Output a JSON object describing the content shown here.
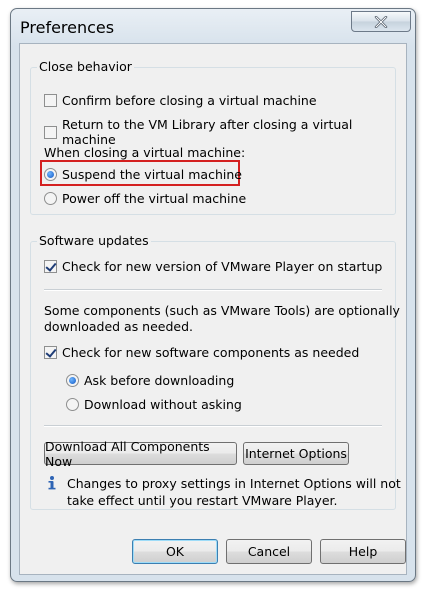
{
  "window": {
    "title": "Preferences"
  },
  "close_behavior": {
    "legend": "Close behavior",
    "confirm_label": "Confirm before closing a virtual machine",
    "confirm_checked": false,
    "return_label": "Return to the VM Library after closing a virtual machine",
    "return_checked": false,
    "when_closing_label": "When closing a virtual machine:",
    "suspend_label": "Suspend the virtual machine",
    "suspend_selected": true,
    "poweroff_label": "Power off the virtual machine",
    "poweroff_selected": false
  },
  "software_updates": {
    "legend": "Software updates",
    "check_version_label": "Check for new version of VMware Player on startup",
    "check_version_checked": true,
    "components_note_line1": "Some components (such as VMware Tools) are optionally",
    "components_note_line2": "downloaded as needed.",
    "check_components_label": "Check for new software components as needed",
    "check_components_checked": true,
    "ask_label": "Ask before downloading",
    "ask_selected": true,
    "download_label": "Download without asking",
    "download_selected": false,
    "download_all_button": "Download All Components Now",
    "internet_options_button": "Internet Options",
    "proxy_note_line1": "Changes to proxy settings in Internet Options will not",
    "proxy_note_line2": "take effect until you restart VMware Player."
  },
  "buttons": {
    "ok": "OK",
    "cancel": "Cancel",
    "help": "Help"
  },
  "icons": {
    "close": "close-icon",
    "info": "info-icon"
  },
  "colors": {
    "highlight": "#d42020",
    "radio_fill": "#1258c4"
  }
}
